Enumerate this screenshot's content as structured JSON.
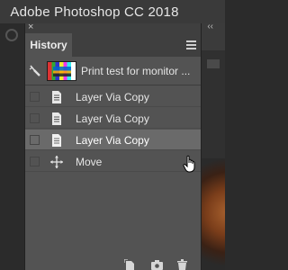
{
  "window": {
    "title": "Adobe Photoshop CC 2018"
  },
  "panel": {
    "tab_label": "History",
    "close_glyph": "×",
    "collapse_glyph": "‹‹",
    "menu_icon": "hamburger-menu-icon",
    "snapshot": {
      "label": "Print test for monitor ...",
      "icon": "history-brush-icon"
    },
    "steps": [
      {
        "label": "Layer Via Copy",
        "icon": "document-icon",
        "selected": false
      },
      {
        "label": "Layer Via Copy",
        "icon": "document-icon",
        "selected": false
      },
      {
        "label": "Layer Via Copy",
        "icon": "document-icon",
        "selected": true
      },
      {
        "label": "Move",
        "icon": "move-arrows-icon",
        "selected": false
      }
    ],
    "bottom_icons": [
      "new-document-from-state-icon",
      "camera-snapshot-icon",
      "trash-icon"
    ]
  },
  "colors": {
    "panel_bg": "#535353",
    "selected_row": "#6a6a6a",
    "title_bar": "#3a3a3a"
  }
}
